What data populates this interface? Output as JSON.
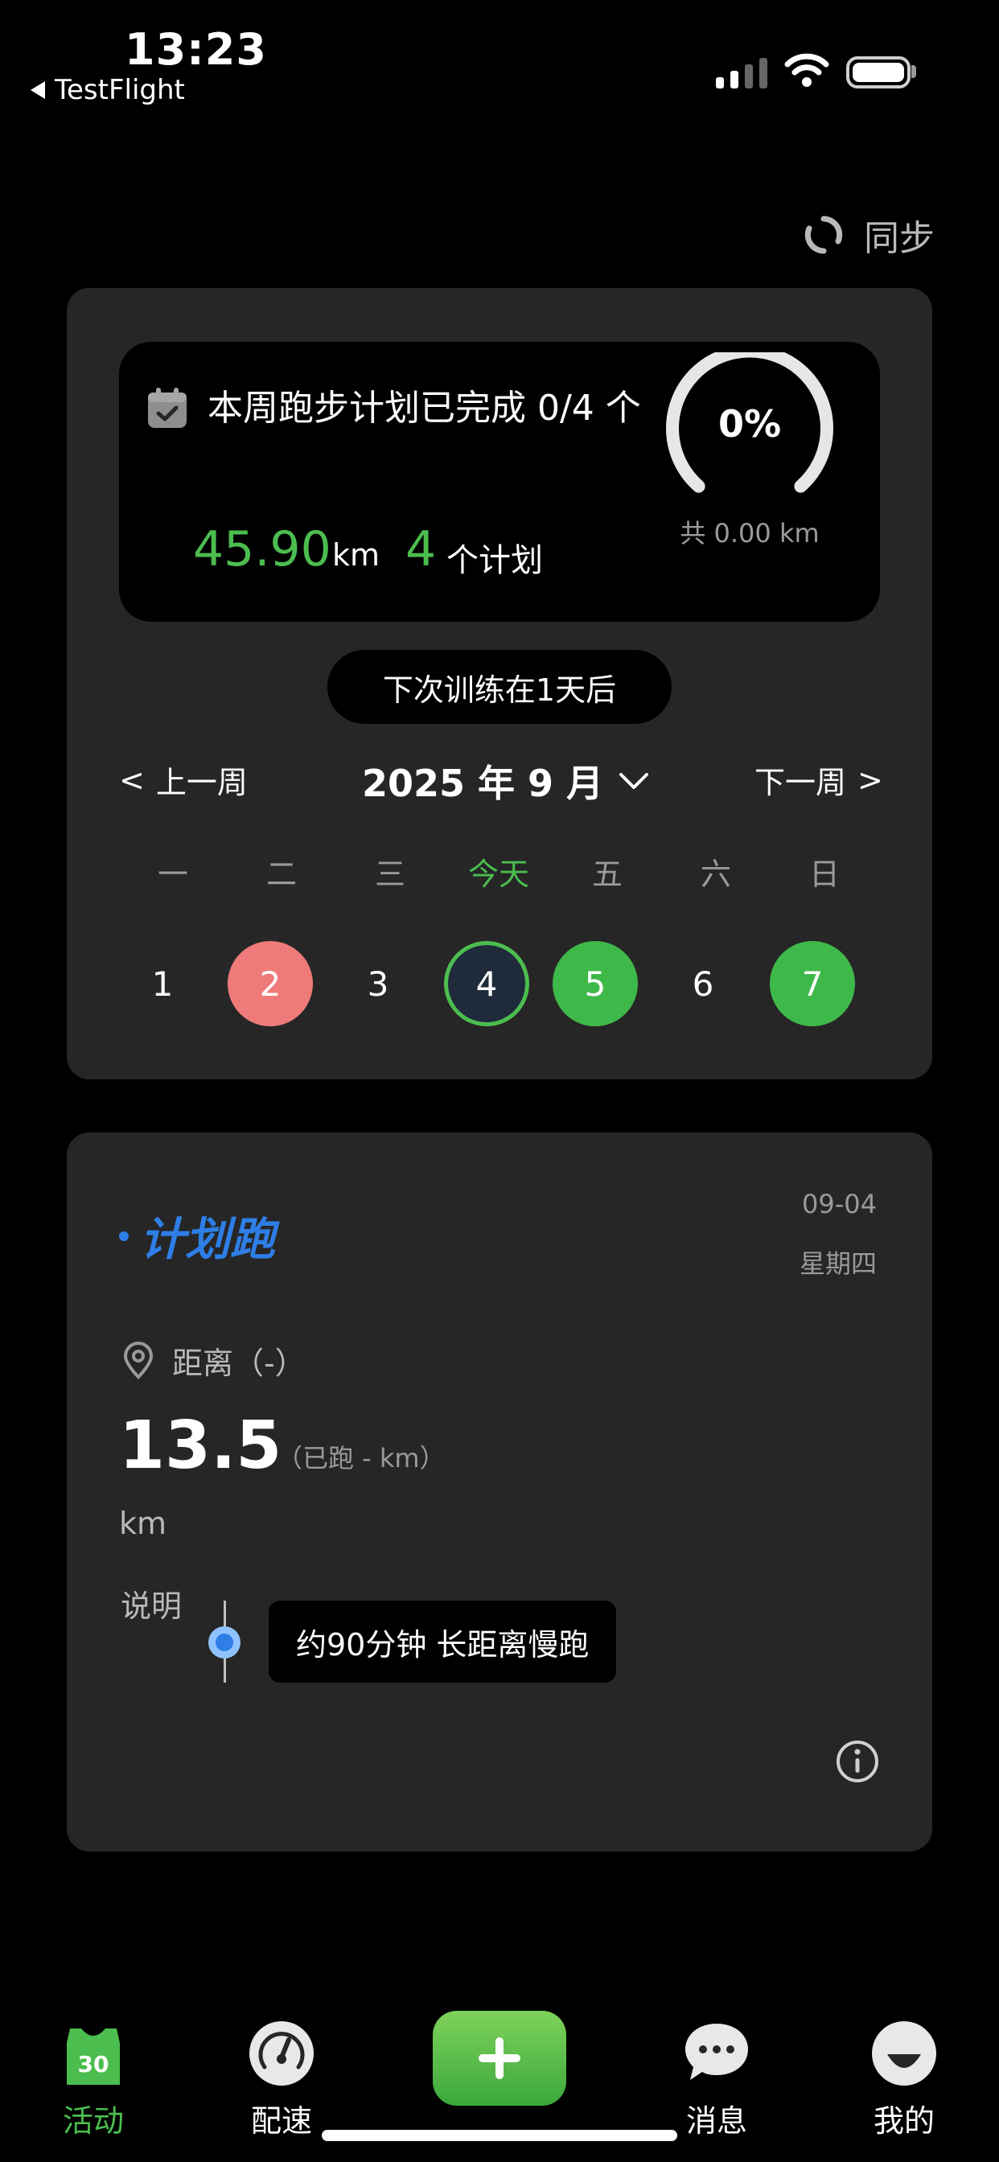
{
  "status_bar": {
    "time": "13:23",
    "back_app": "TestFlight"
  },
  "header": {
    "sync_label": "同步"
  },
  "weekly_summary": {
    "title": "本周跑步计划已完成 0/4 个",
    "distance_value": "45.90",
    "distance_unit": "km",
    "plans_count": "4",
    "plans_unit": "个计划",
    "progress_percent": "0%",
    "progress_fraction": 0,
    "total_distance": "共 0.00 km",
    "next_training": "下次训练在1天后"
  },
  "calendar": {
    "prev_week": "上一周",
    "month": "2025 年 9 月",
    "next_week": "下一周",
    "weekdays": [
      "一",
      "二",
      "三",
      "今天",
      "五",
      "六",
      "日"
    ],
    "days": [
      "1",
      "2",
      "3",
      "4",
      "5",
      "6",
      "7"
    ]
  },
  "plan_card": {
    "name": "计划跑",
    "date": "09-04",
    "weekday": "星期四",
    "distance_label": "距离（-）",
    "distance_value": "13.5",
    "distance_run": "（已跑 - km）",
    "distance_unit": "km",
    "note_label": "说明",
    "note_text": "约90分钟 长距离慢跑"
  },
  "tab_bar": {
    "activity": "活动",
    "pace": "配速",
    "messages": "消息",
    "mine": "我的",
    "activity_badge": "30"
  },
  "colors": {
    "accent_green": "#4cbd4f",
    "accent_blue": "#2e7ee6",
    "missed_red": "#ef7a7a"
  }
}
